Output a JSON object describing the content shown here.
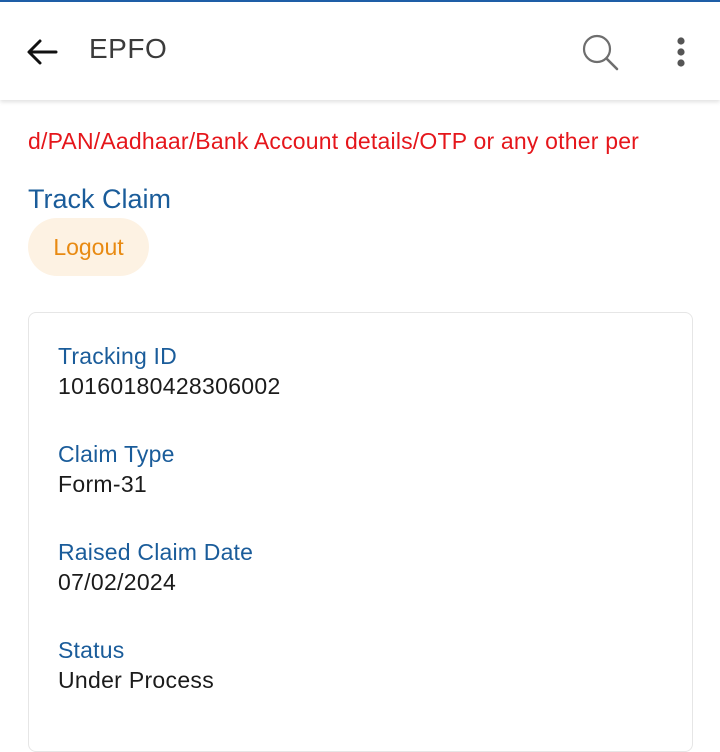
{
  "app_bar": {
    "title": "EPFO",
    "back_icon": "arrow-left-icon",
    "search_icon": "search-icon",
    "more_icon": "more-vertical-icon"
  },
  "marquee": {
    "text": "Do not share your UAN/Password/PAN/Aadhaar/Bank Account details/OTP or any other per",
    "color": "#e5161b"
  },
  "page": {
    "title": "Track Claim",
    "logout_label": "Logout"
  },
  "claim": {
    "tracking_id_label": "Tracking ID",
    "tracking_id_value": "10160180428306002",
    "claim_type_label": "Claim Type",
    "claim_type_value": "Form-31",
    "raised_date_label": "Raised Claim Date",
    "raised_date_value": "07/02/2024",
    "status_label": "Status",
    "status_value": "Under Process"
  },
  "colors": {
    "accent": "#1a5c9a",
    "logout_text": "#e88a12",
    "logout_bg": "#fdf2e3"
  }
}
